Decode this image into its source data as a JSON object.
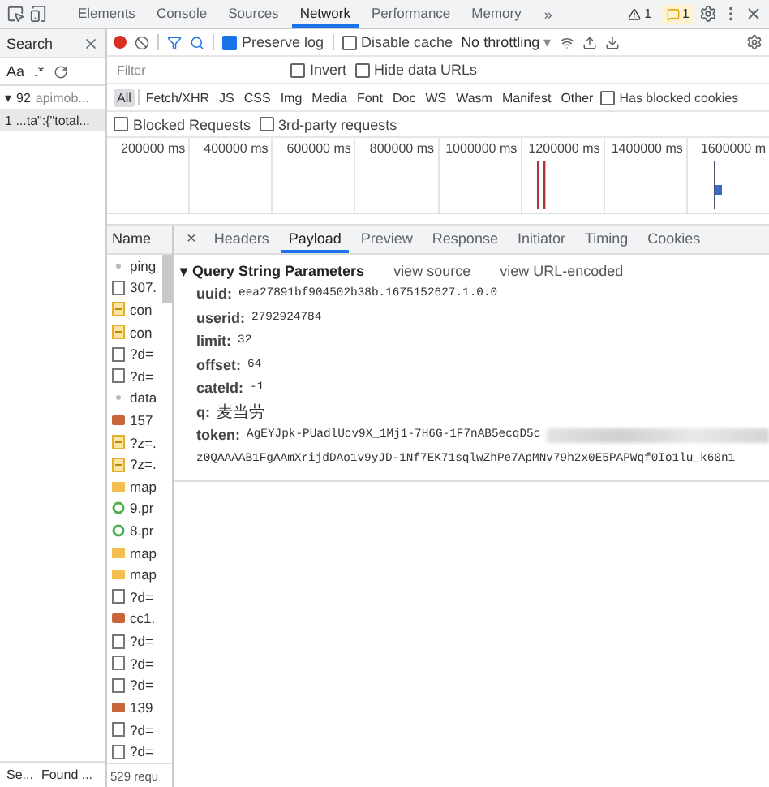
{
  "devtools_tabs": [
    {
      "label": "Elements",
      "selected": false
    },
    {
      "label": "Console",
      "selected": false
    },
    {
      "label": "Sources",
      "selected": false
    },
    {
      "label": "Network",
      "selected": true
    },
    {
      "label": "Performance",
      "selected": false
    },
    {
      "label": "Memory",
      "selected": false
    }
  ],
  "more_tabs": "»",
  "badges": [
    {
      "kind": "warning",
      "count": "1"
    },
    {
      "kind": "issue",
      "count": "1"
    }
  ],
  "search_panel": {
    "title": "Search",
    "options": [
      "Aa",
      ".*"
    ],
    "results": [
      {
        "toggle": "▾",
        "count": "92",
        "file": "apimob...",
        "expanded": true,
        "children": [
          {
            "line": "1",
            "text": "...ta\":{\"total..."
          }
        ]
      }
    ],
    "status": [
      "Se...",
      "Found ..."
    ]
  },
  "toolbar": {
    "recording": true,
    "preserve_log": {
      "label": "Preserve log",
      "checked": true
    },
    "disable_cache": {
      "label": "Disable cache",
      "checked": false
    },
    "throttling": "No throttling",
    "throttling_caret": "▾"
  },
  "filter": {
    "placeholder": "Filter",
    "invert": {
      "label": "Invert",
      "checked": false
    },
    "hide_data_urls": {
      "label": "Hide data URLs",
      "checked": false
    }
  },
  "types": [
    {
      "label": "All",
      "selected": true
    },
    {
      "label": "Fetch/XHR",
      "selected": false
    },
    {
      "label": "JS",
      "selected": false
    },
    {
      "label": "CSS",
      "selected": false
    },
    {
      "label": "Img",
      "selected": false
    },
    {
      "label": "Media",
      "selected": false
    },
    {
      "label": "Font",
      "selected": false
    },
    {
      "label": "Doc",
      "selected": false
    },
    {
      "label": "WS",
      "selected": false
    },
    {
      "label": "Wasm",
      "selected": false
    },
    {
      "label": "Manifest",
      "selected": false
    },
    {
      "label": "Other",
      "selected": false
    }
  ],
  "has_blocked_cookies": {
    "label": "Has blocked cookies",
    "checked": false
  },
  "blocked_requests": {
    "label": "Blocked Requests",
    "checked": false
  },
  "third_party": {
    "label": "3rd-party requests",
    "checked": false
  },
  "timeline_ticks": [
    "200000 ms",
    "400000 ms",
    "600000 ms",
    "800000 ms",
    "1000000 ms",
    "1200000 ms",
    "1400000 ms",
    "1600000 m"
  ],
  "requests": {
    "header": "Name",
    "rows": [
      {
        "name": "ping",
        "kind": "other"
      },
      {
        "name": "307.",
        "kind": "doc"
      },
      {
        "name": "con",
        "kind": "script"
      },
      {
        "name": "con",
        "kind": "script"
      },
      {
        "name": "?d=",
        "kind": "doc"
      },
      {
        "name": "?d=",
        "kind": "doc"
      },
      {
        "name": "data",
        "kind": "other"
      },
      {
        "name": "157",
        "kind": "image"
      },
      {
        "name": "?z=.",
        "kind": "script"
      },
      {
        "name": "?z=.",
        "kind": "script"
      },
      {
        "name": "map",
        "kind": "style"
      },
      {
        "name": "9.pr",
        "kind": "font"
      },
      {
        "name": "8.pr",
        "kind": "font"
      },
      {
        "name": "map",
        "kind": "style"
      },
      {
        "name": "map",
        "kind": "style"
      },
      {
        "name": "?d=",
        "kind": "doc"
      },
      {
        "name": "cc1.",
        "kind": "image"
      },
      {
        "name": "?d=",
        "kind": "doc"
      },
      {
        "name": "?d=",
        "kind": "doc"
      },
      {
        "name": "?d=",
        "kind": "doc"
      },
      {
        "name": "139",
        "kind": "image"
      },
      {
        "name": "?d=",
        "kind": "doc"
      },
      {
        "name": "?d=",
        "kind": "doc"
      }
    ],
    "footer": "529 requ"
  },
  "detail": {
    "close": "×",
    "tabs": [
      {
        "label": "Headers",
        "selected": false
      },
      {
        "label": "Payload",
        "selected": true
      },
      {
        "label": "Preview",
        "selected": false
      },
      {
        "label": "Response",
        "selected": false
      },
      {
        "label": "Initiator",
        "selected": false
      },
      {
        "label": "Timing",
        "selected": false
      },
      {
        "label": "Cookies",
        "selected": false
      }
    ],
    "section": {
      "toggle": "▾",
      "title": "Query String Parameters",
      "expanded": true,
      "links": [
        "view source",
        "view URL-encoded"
      ],
      "params": [
        {
          "key": "uuid:",
          "value": "eea27891bf904502b38b.1675152627.1.0.0"
        },
        {
          "key": "userid:",
          "value": "2792924784"
        },
        {
          "key": "limit:",
          "value": "32"
        },
        {
          "key": "offset:",
          "value": "64"
        },
        {
          "key": "cateId:",
          "value": "-1"
        },
        {
          "key": "q:",
          "value": "麦当劳"
        },
        {
          "key": "token:",
          "value": "AgEYJpk-PUadlUcv9X_1Mj1-7H6G-1F7nAB5ecqD5c",
          "redacted": true,
          "continuation": "z0QAAAAB1FgAAmXrijdDAo1v9yJD-1Nf7EK71sqlwZhPe7ApMNv79h2x0E5PAPWqf0Io1lu_k60n1"
        }
      ]
    }
  }
}
